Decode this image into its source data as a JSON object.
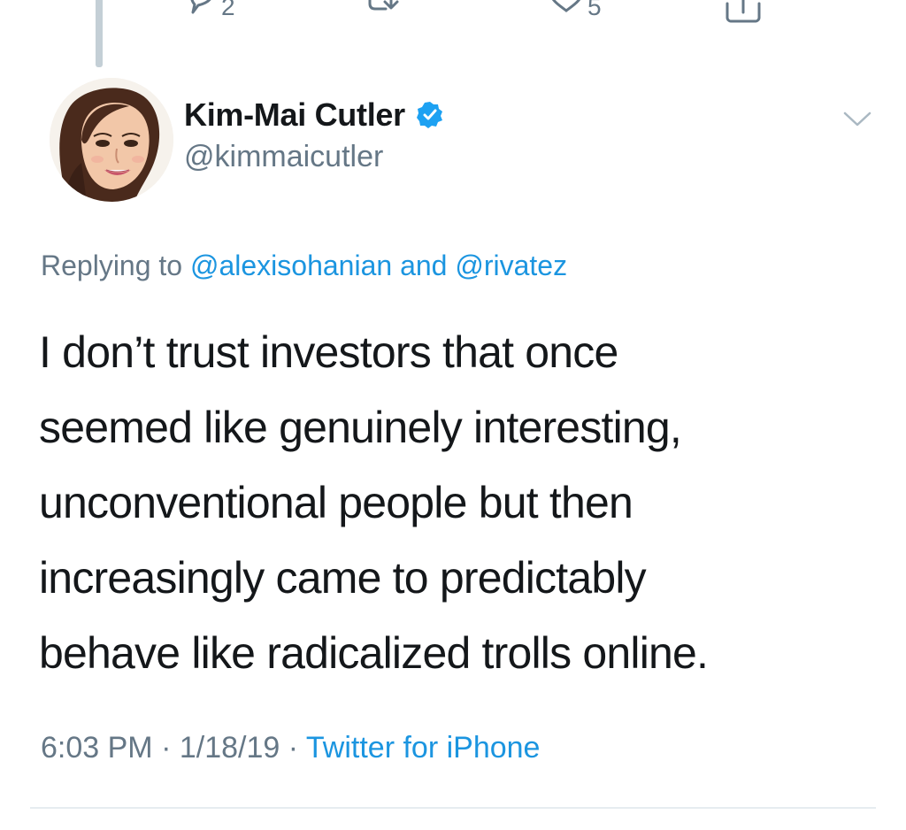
{
  "prev_tweet": {
    "reply_count": "2",
    "like_count": "5",
    "icons": [
      "reply-icon",
      "retweet-icon",
      "like-icon",
      "share-icon"
    ]
  },
  "tweet": {
    "author": {
      "display_name": "Kim-Mai Cutler",
      "handle": "@kimmaicutler",
      "verified": true
    },
    "replying": {
      "prefix": "Replying to ",
      "mention_1": "@alexisohanian",
      "joiner": " and ",
      "mention_2": "@rivatez"
    },
    "text_lines": [
      "I don’t trust investors that once",
      "seemed like genuinely interesting,",
      "unconventional people but then",
      "increasingly came to predictably",
      "behave like radicalized trolls online."
    ],
    "time": "6:03 PM",
    "separator": " · ",
    "date": "1/18/19",
    "source": "Twitter for iPhone"
  },
  "colors": {
    "text": "#14171a",
    "secondary": "#657786",
    "link": "#1b95e0",
    "verified_badge": "#1da1f2",
    "divider": "#e6ecf0"
  }
}
